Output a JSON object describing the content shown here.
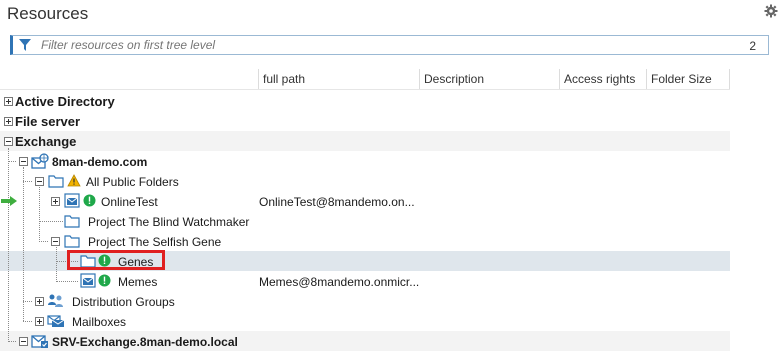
{
  "panel": {
    "title": "Resources"
  },
  "filter": {
    "placeholder": "Filter resources on first tree level",
    "count": "2"
  },
  "columns": {
    "full_path": "full path",
    "description": "Description",
    "access_rights": "Access rights",
    "folder_size": "Folder Size"
  },
  "tree": {
    "active_directory": "Active Directory",
    "file_server": "File server",
    "exchange": "Exchange",
    "domain": "8man-demo.com",
    "all_public_folders": "All Public Folders",
    "online_test": "OnlineTest",
    "online_test_path": "OnlineTest@8mandemo.on...",
    "blind_watchmaker": "Project The Blind Watchmaker",
    "selfish_gene": "Project The Selfish Gene",
    "genes": "Genes",
    "memes": "Memes",
    "memes_path": "Memes@8mandemo.onmicr...",
    "distribution_groups": "Distribution Groups",
    "mailboxes": "Mailboxes",
    "srv_exchange": "SRV-Exchange.8man-demo.local"
  },
  "colors": {
    "accent": "#2f74b5",
    "highlight": "#e02020",
    "status_green": "#1fa84a",
    "warning": "#f2b300",
    "arrow": "#3fae3f"
  }
}
